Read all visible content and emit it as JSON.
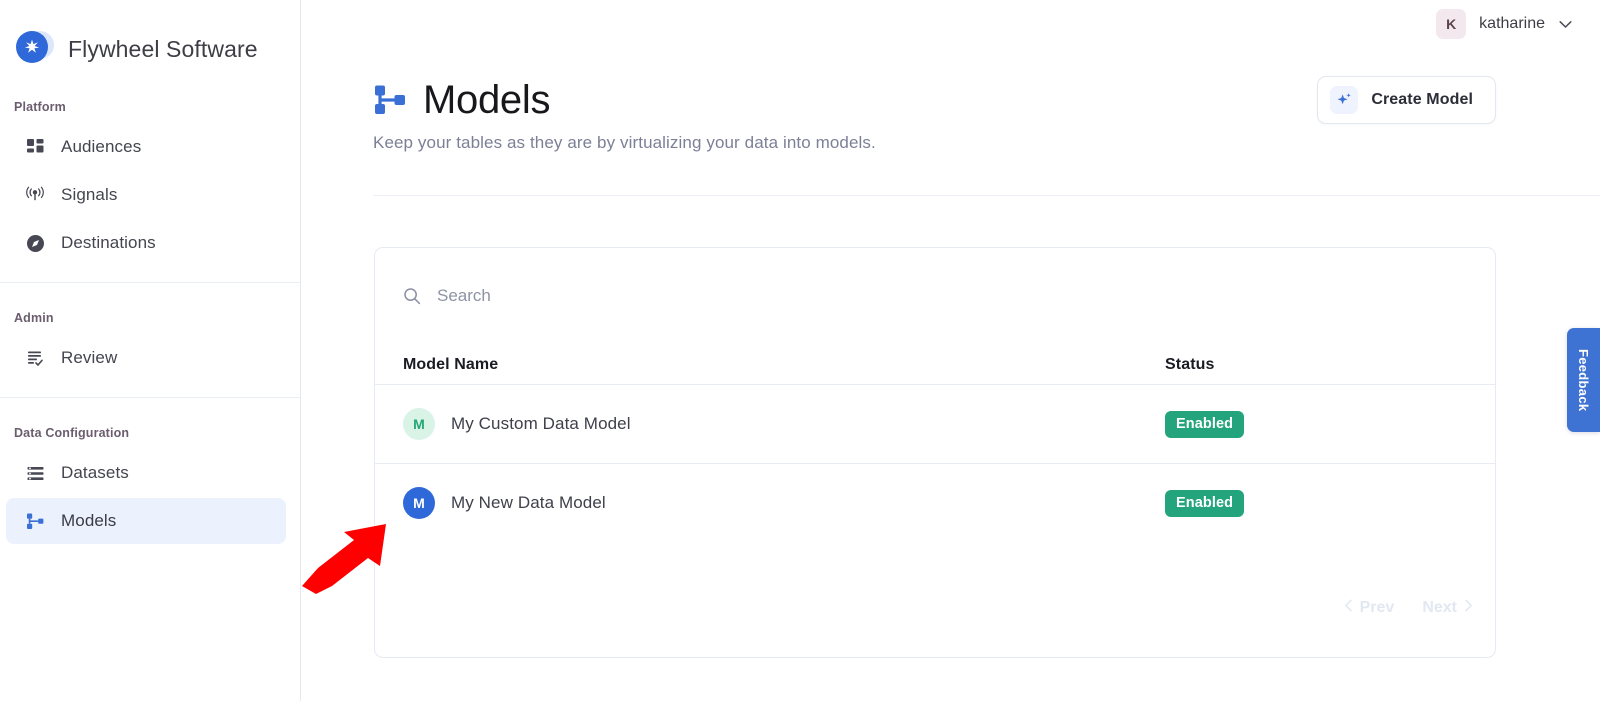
{
  "brand": {
    "name": "Flywheel Software",
    "logo_icon": "sparkle-star-icon",
    "color": "#2F68D8"
  },
  "sidebar": {
    "sections": [
      {
        "label": "Platform",
        "items": [
          {
            "label": "Audiences",
            "icon": "grid-blocks-icon",
            "active": false
          },
          {
            "label": "Signals",
            "icon": "broadcast-antenna-icon",
            "active": false
          },
          {
            "label": "Destinations",
            "icon": "compass-icon",
            "active": false
          }
        ]
      },
      {
        "label": "Admin",
        "items": [
          {
            "label": "Review",
            "icon": "list-check-icon",
            "active": false
          }
        ]
      },
      {
        "label": "Data Configuration",
        "items": [
          {
            "label": "Datasets",
            "icon": "rows-list-icon",
            "active": false
          },
          {
            "label": "Models",
            "icon": "model-tree-icon",
            "active": true
          }
        ]
      }
    ],
    "active_item_bg": "#EBF2FD"
  },
  "topbar": {
    "user": {
      "initial": "K",
      "name": "katharine",
      "chevron_icon": "chevron-down-icon",
      "avatar_bg": "#F3E8EE"
    }
  },
  "header": {
    "title": "Models",
    "title_icon": "model-tree-icon",
    "subtitle": "Keep your tables as they are by virtualizing your data into models.",
    "create_button": {
      "label": "Create Model",
      "icon": "sparkle-plus-icon"
    }
  },
  "search": {
    "placeholder": "Search",
    "value": "",
    "icon": "search-icon"
  },
  "table": {
    "columns": [
      "Model Name",
      "Status"
    ],
    "rows": [
      {
        "avatar_letter": "M",
        "avatar_bg": "#D9F3E7",
        "avatar_fg": "#25A578",
        "name": "My Custom Data Model",
        "status": "Enabled",
        "status_color": "#23A47C"
      },
      {
        "avatar_letter": "M",
        "avatar_bg": "#2F68D8",
        "avatar_fg": "#FFFFFF",
        "name": "My New Data Model",
        "status": "Enabled",
        "status_color": "#23A47C"
      }
    ]
  },
  "pagination": {
    "prev": "Prev",
    "next": "Next",
    "prev_icon": "chevron-left-icon",
    "next_icon": "chevron-right-icon"
  },
  "feedback_tab": {
    "label": "Feedback",
    "color": "#3E72D3"
  },
  "annotation": {
    "type": "red-arrow",
    "color": "#FF0000"
  }
}
